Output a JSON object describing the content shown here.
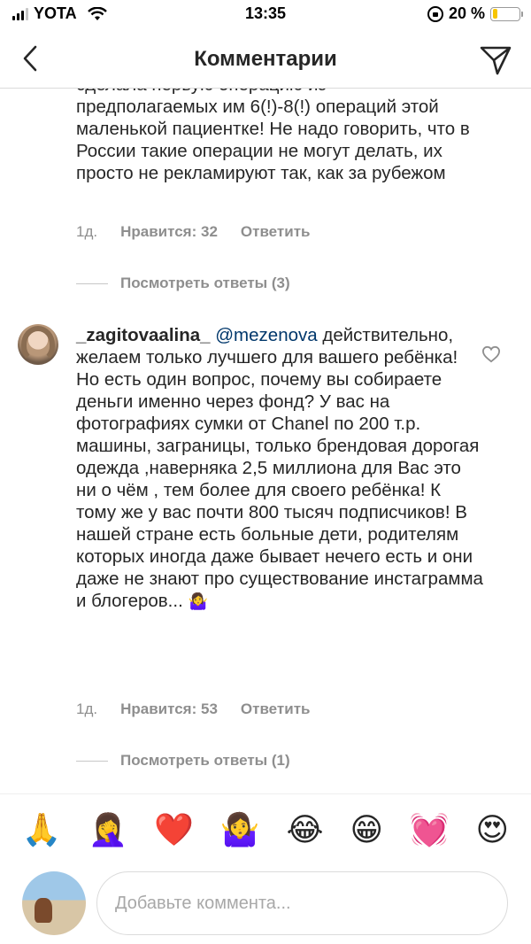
{
  "status_bar": {
    "carrier": "YOTA",
    "time": "13:35",
    "battery": "20 %",
    "battery_level": 0.2,
    "battery_color": "#f7c500"
  },
  "header": {
    "title": "Комментарии",
    "back_icon": "chevron-left-icon",
    "send_icon": "paper-plane-icon"
  },
  "comments": [
    {
      "text_partial_top": "сделала первую операцию из",
      "text": "предполагаемых им 6(!)-8(!) операций этой маленькой пациентке! Не надо говорить, что в России такие операции не могут делать, их просто не рекламируют так, как за рубежом",
      "age": "1д.",
      "likes": "Нравится: 32",
      "reply": "Ответить",
      "view_replies": "Посмотреть ответы (3)"
    },
    {
      "username": "_zagitovaalina_",
      "mention": "@mezenova",
      "text": "действительно, желаем только лучшего для вашего ребёнка! Но есть один вопрос, почему вы собираете деньги именно через фонд? У вас на фотографиях сумки от Chanel по 200 т.р. машины, заграницы, только брендовая дорогая одежда ,наверняка 2,5 миллиона для Вас это ни о чём , тем более для своего ребёнка! К тому же у вас почти 800 тысяч подписчиков! В нашей стране есть больные  дети, родителям которых иногда даже бывает нечего есть и они даже не знают про существование инстаграмма и блогеров...",
      "emoji": "🤷‍♀️",
      "age": "1д.",
      "likes": "Нравится: 53",
      "reply": "Ответить",
      "view_replies": "Посмотреть ответы (1)"
    }
  ],
  "emoji_bar": [
    "🙏",
    "🤦‍♀️",
    "❤️",
    "🤷‍♀️",
    "😂",
    "😁",
    "💓",
    "😍"
  ],
  "input": {
    "placeholder": "Добавьте коммента..."
  }
}
